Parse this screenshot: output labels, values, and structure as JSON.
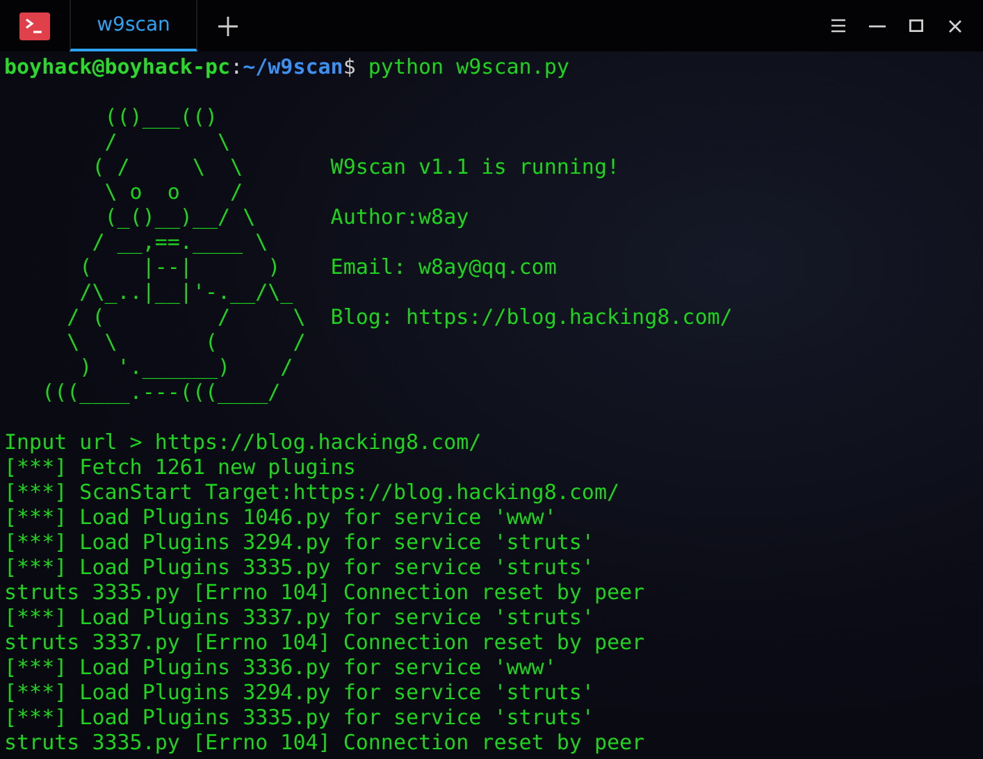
{
  "tabs": [
    {
      "label": "w9scan",
      "selected": true
    }
  ],
  "prompt": {
    "user_host": "boyhack@boyhack-pc",
    "separator": ":",
    "path": "~/w9scan",
    "symbol": "$",
    "command": "python w9scan.py"
  },
  "banner": {
    "art": [
      "        (()___(()",
      "        /        \\",
      "       ( /     \\  \\",
      "        \\ o  o    /",
      "        (_()__)__/ \\",
      "       / __,==.____ \\",
      "      (    |--|      )",
      "      /\\_..|__|'-.__/\\_",
      "     / (         /     \\",
      "     \\  \\       (      /",
      "      )  '.______)    /",
      "   (((____.---(((____/"
    ],
    "info": [
      "W9scan v1.1 is running!",
      "Author:w8ay",
      "Email: w8ay@qq.com",
      "Blog: https://blog.hacking8.com/"
    ]
  },
  "output": [
    "Input url > https://blog.hacking8.com/",
    "[***] Fetch 1261 new plugins",
    "[***] ScanStart Target:https://blog.hacking8.com/",
    "[***] Load Plugins 1046.py for service 'www'",
    "[***] Load Plugins 3294.py for service 'struts'",
    "[***] Load Plugins 3335.py for service 'struts'",
    "struts 3335.py [Errno 104] Connection reset by peer",
    "[***] Load Plugins 3337.py for service 'struts'",
    "struts 3337.py [Errno 104] Connection reset by peer",
    "[***] Load Plugins 3336.py for service 'www'",
    "[***] Load Plugins 3294.py for service 'struts'",
    "[***] Load Plugins 3335.py for service 'struts'",
    "struts 3335.py [Errno 104] Connection reset by peer"
  ]
}
